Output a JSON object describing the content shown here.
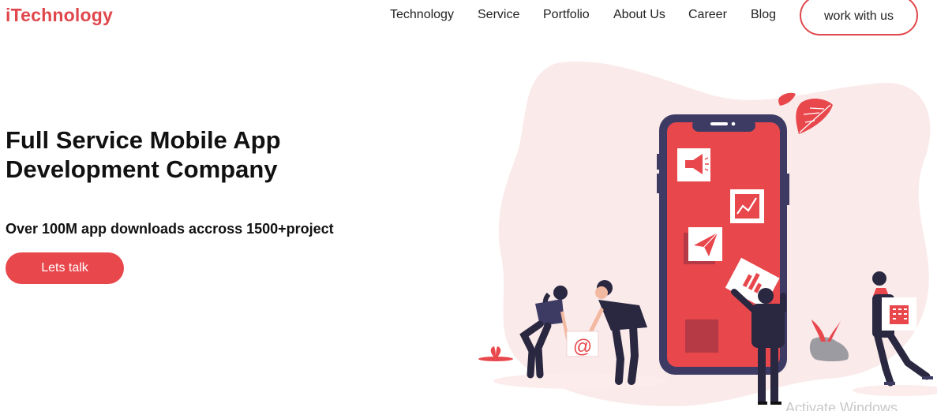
{
  "brand": {
    "logo_text": "iTechnology",
    "accent_color": "#e0474c"
  },
  "nav": {
    "links": [
      "Technology",
      "Service",
      "Portfolio",
      "About Us",
      "Career",
      "Blog"
    ],
    "cta_label": "work with us"
  },
  "hero": {
    "title_line1": "Full Service Mobile App",
    "title_line2": "Development Company",
    "subtitle": "Over 100M app downloads accross 1500+project",
    "button_label": "Lets talk"
  },
  "illustration": {
    "icons": [
      "megaphone-icon",
      "chart-icon",
      "paper-plane-icon",
      "bar-chart-icon",
      "email-icon",
      "building-icon",
      "leaf-icon",
      "plant-icon"
    ],
    "email_symbol": "@"
  },
  "watermark": {
    "text": "Activate Windows"
  }
}
